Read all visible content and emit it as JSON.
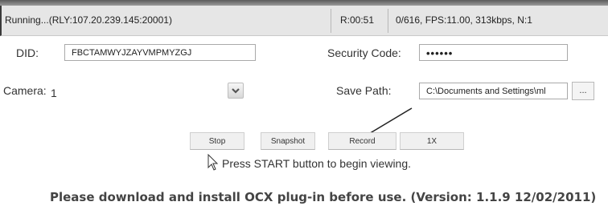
{
  "status": {
    "main": "Running...(RLY:107.20.239.145:20001)",
    "time": "R:00:51",
    "stats": "0/616, FPS:11.00, 313kbps, N:1"
  },
  "form": {
    "did_label": "DID:",
    "did_value": "FBCTAMWYJZAYVMPMYZGJ",
    "security_label": "Security Code:",
    "security_value": "••••••",
    "camera_label": "Camera:",
    "camera_value": "1",
    "save_label": "Save Path:",
    "save_value": "C:\\Documents and Settings\\ml",
    "browse_label": "..."
  },
  "buttons": {
    "stop": "Stop",
    "snapshot": "Snapshot",
    "record": "Record",
    "speed": "1X"
  },
  "hint": "Press START button to begin viewing.",
  "notice": "Please download and install OCX plug-in before use. (Version: 1.1.9 12/02/2011)",
  "icons": {
    "dropdown": "chevron-down-icon",
    "cursor": "mouse-pointer-icon",
    "annotation": "arrow-icon"
  }
}
